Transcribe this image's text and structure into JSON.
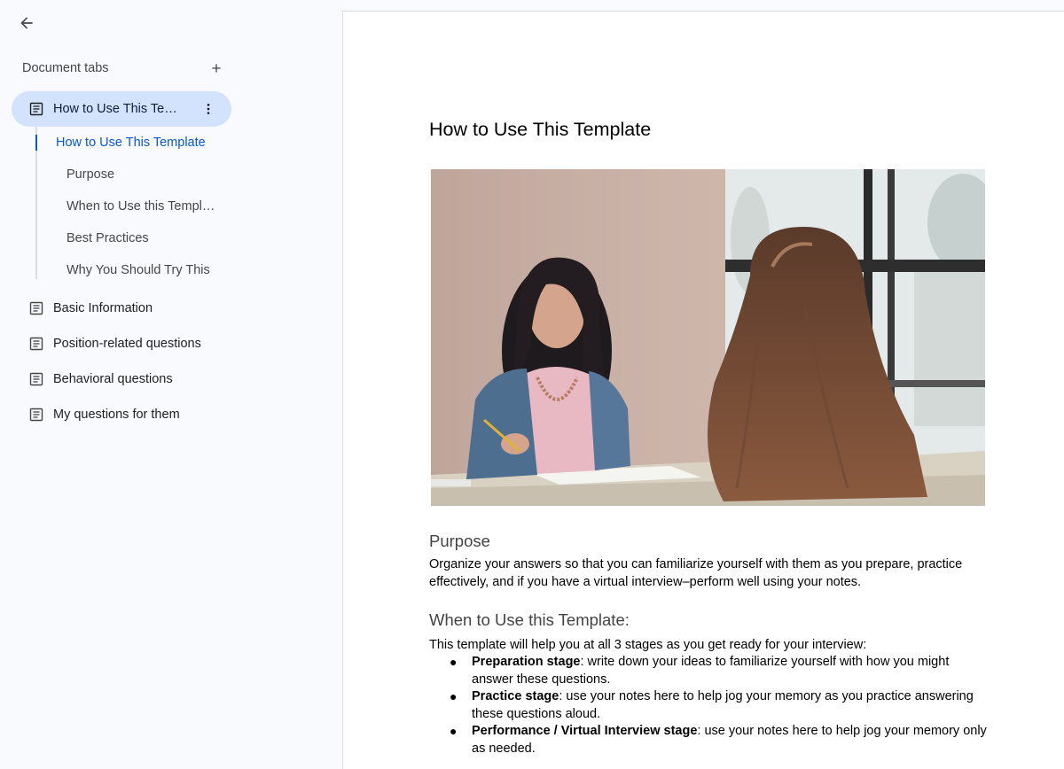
{
  "sidebar": {
    "header_label": "Document tabs",
    "tabs": [
      {
        "label": "How to Use This Temp…",
        "active": true
      },
      {
        "label": "Basic Information"
      },
      {
        "label": "Position-related questions"
      },
      {
        "label": "Behavioral questions"
      },
      {
        "label": "My questions for them"
      }
    ],
    "outline": [
      {
        "label": "How to Use This Template",
        "active": true
      },
      {
        "label": "Purpose"
      },
      {
        "label": "When to Use this Templ…"
      },
      {
        "label": "Best Practices"
      },
      {
        "label": "Why You Should Try This"
      }
    ],
    "icons": {
      "back": "arrow-back-icon",
      "add": "plus-icon",
      "doc": "document-icon",
      "more": "more-vertical-icon"
    }
  },
  "document": {
    "title": "How to Use This Template",
    "image_alt": "Two women at a desk during an interview",
    "purpose": {
      "heading": "Purpose",
      "text": "Organize your answers so that you can familiarize yourself with them as you prepare, practice effectively, and if you have a virtual interview–perform well using your notes."
    },
    "when": {
      "heading": "When to Use this Template:",
      "intro": "This template will help you at all 3 stages as you get ready for your interview:",
      "bullets": [
        {
          "bold": "Preparation stage",
          "text": ": write down your ideas to familiarize yourself with how you might answer these questions."
        },
        {
          "bold": "Practice stage",
          "text": ": use your notes here to help jog your memory as you practice answering these questions aloud."
        },
        {
          "bold": "Performance / Virtual Interview stage",
          "text": ": use your notes here to help jog your memory only as needed."
        }
      ]
    }
  },
  "colors": {
    "active_tab_bg": "#d3e3fd",
    "accent_blue": "#0b57d0",
    "sidebar_bg": "#f8fafd"
  }
}
